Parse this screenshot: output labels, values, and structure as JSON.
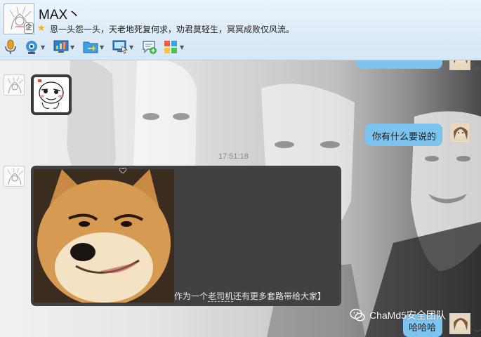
{
  "header": {
    "contact_name": "MAX丶",
    "signature": "恩一头怨一头，天老地死复何求，劝君莫轻生，冥冥成败仅风流。",
    "qq_badge": "企",
    "toolbar": [
      {
        "icon": "microphone-icon",
        "has_dropdown": false
      },
      {
        "icon": "webcam-icon",
        "has_dropdown": true
      },
      {
        "icon": "screen-share-icon",
        "has_dropdown": true
      },
      {
        "icon": "file-transfer-icon",
        "has_dropdown": true
      },
      {
        "icon": "remote-desktop-icon",
        "has_dropdown": true
      },
      {
        "icon": "add-chat-icon",
        "has_dropdown": false
      },
      {
        "icon": "apps-icon",
        "has_dropdown": true
      }
    ]
  },
  "chat": {
    "timestamp": "17:51:18",
    "messages": [
      {
        "side": "right",
        "type": "text",
        "text": ""
      },
      {
        "side": "left",
        "type": "sticker",
        "text": ""
      },
      {
        "side": "right",
        "type": "text",
        "text": "你有什么要说的"
      },
      {
        "side": "left",
        "type": "image",
        "caption_prefix": "作为一个",
        "caption_underlined": "老司机",
        "caption_suffix": "还有更多套路带给大家】"
      },
      {
        "side": "right",
        "type": "text",
        "text": "哈哈哈"
      }
    ],
    "watermark": "ChaMd5安全团队",
    "colors": {
      "outgoing_bubble": "#7cc3f0",
      "image_card": "#414141"
    }
  }
}
